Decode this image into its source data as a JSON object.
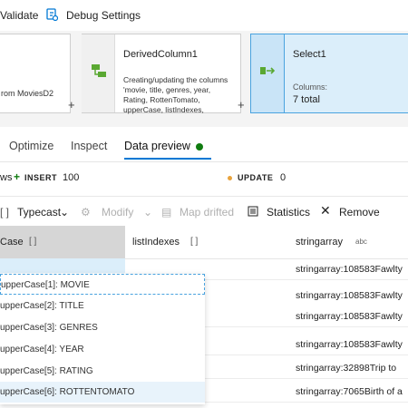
{
  "toolbar": {
    "validate": "Validate",
    "debug_settings": "Debug Settings"
  },
  "flow": {
    "source_node": {
      "text": "rom MoviesD2"
    },
    "derived_node": {
      "title": "DerivedColumn1",
      "description": "Creating/updating the columns 'movie, title, genres, year, Rating, RottenTomato, upperCase, listIndexes,"
    },
    "select_node": {
      "title": "Select1",
      "columns_label": "Columns:",
      "columns_value": "7 total"
    },
    "plus": "+"
  },
  "tabs": [
    {
      "label": "Optimize"
    },
    {
      "label": "Inspect"
    },
    {
      "label": "Data preview"
    }
  ],
  "stats": {
    "rows_prefix": "ws",
    "insert_label": "INSERT",
    "insert_count": "100",
    "update_label": "UPDATE",
    "update_count": "0"
  },
  "actions": {
    "typecast": "Typecast",
    "modify": "Modify",
    "map_drifted": "Map drifted",
    "statistics": "Statistics",
    "remove": "Remove"
  },
  "grid": {
    "headers": [
      {
        "label": "Case",
        "type": "[ ]"
      },
      {
        "label": "listIndexes",
        "type": "[ ]"
      },
      {
        "label": "stringarray",
        "type": "abc"
      }
    ],
    "rows": [
      {
        "stringarray": "stringarray:108583Fawlty"
      },
      {
        "stringarray": "stringarray:108583Fawlty"
      },
      {
        "stringarray": "stringarray:108583Fawlty"
      },
      {
        "stringarray": "stringarray:108583Fawlty"
      },
      {
        "stringarray": "stringarray:32898Trip to"
      },
      {
        "stringarray": "stringarray:7065Birth of a"
      }
    ]
  },
  "popup": {
    "items": [
      "upperCase[1]: MOVIE",
      "upperCase[2]: TITLE",
      "upperCase[3]: GENRES",
      "upperCase[4]: YEAR",
      "upperCase[5]: RATING",
      "upperCase[6]: ROTTENTOMATO"
    ]
  },
  "colors": {
    "accent": "#0078d4",
    "green": "#107c10",
    "select_bg": "#dbeefa",
    "select_border": "#4aa3df"
  }
}
